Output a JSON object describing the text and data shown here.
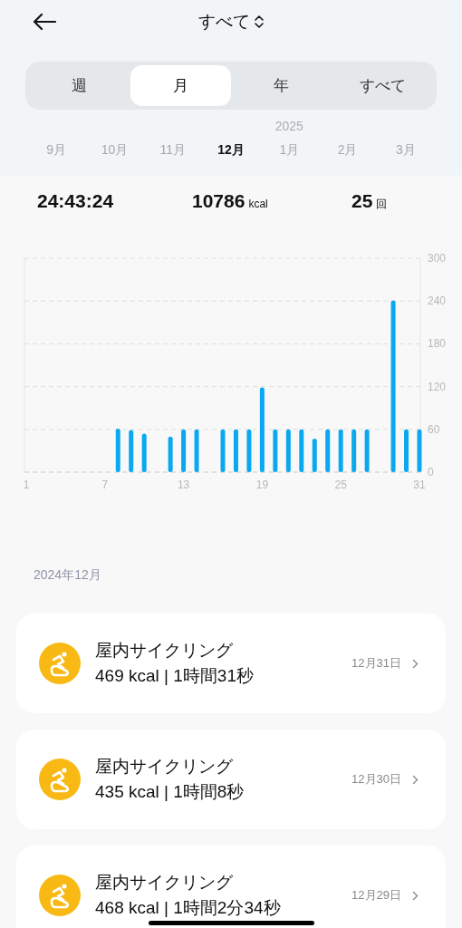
{
  "header": {
    "title": "すべて"
  },
  "tabs": [
    {
      "label": "週",
      "selected": false
    },
    {
      "label": "月",
      "selected": true
    },
    {
      "label": "年",
      "selected": false
    },
    {
      "label": "すべて",
      "selected": false
    }
  ],
  "months": [
    {
      "label": "9月",
      "selected": false
    },
    {
      "label": "10月",
      "selected": false
    },
    {
      "label": "11月",
      "selected": false
    },
    {
      "label": "12月",
      "selected": true
    },
    {
      "label": "1月",
      "selected": false,
      "year": "2025"
    },
    {
      "label": "2月",
      "selected": false
    },
    {
      "label": "3月",
      "selected": false
    }
  ],
  "summary": [
    {
      "value": "24:43:24"
    },
    {
      "value": "10786",
      "unit": "kcal"
    },
    {
      "value": "25",
      "unit": "回"
    }
  ],
  "chart_data": {
    "type": "bar",
    "grid": true,
    "x": [
      8,
      9,
      10,
      12,
      13,
      14,
      16,
      17,
      18,
      19,
      20,
      21,
      22,
      23,
      24,
      25,
      26,
      27,
      29,
      30,
      31
    ],
    "values": [
      61,
      59,
      54,
      50,
      60,
      60,
      60,
      60,
      60,
      119,
      60,
      60,
      60,
      47,
      60,
      60,
      60,
      60,
      241,
      60,
      60
    ],
    "xticks": [
      1,
      7,
      13,
      19,
      25,
      31
    ],
    "yticks": [
      0,
      60,
      120,
      180,
      240,
      300
    ],
    "ylim": [
      0,
      300
    ],
    "xlim": [
      1,
      31
    ]
  },
  "list": {
    "heading": "2024年12月",
    "items": [
      {
        "title": "屋内サイクリング",
        "detail": "469 kcal | 1時間31秒",
        "date": "12月31日"
      },
      {
        "title": "屋内サイクリング",
        "detail": "435 kcal | 1時間8秒",
        "date": "12月30日"
      },
      {
        "title": "屋内サイクリング",
        "detail": "468 kcal | 1時間2分34秒",
        "date": "12月29日"
      }
    ]
  }
}
